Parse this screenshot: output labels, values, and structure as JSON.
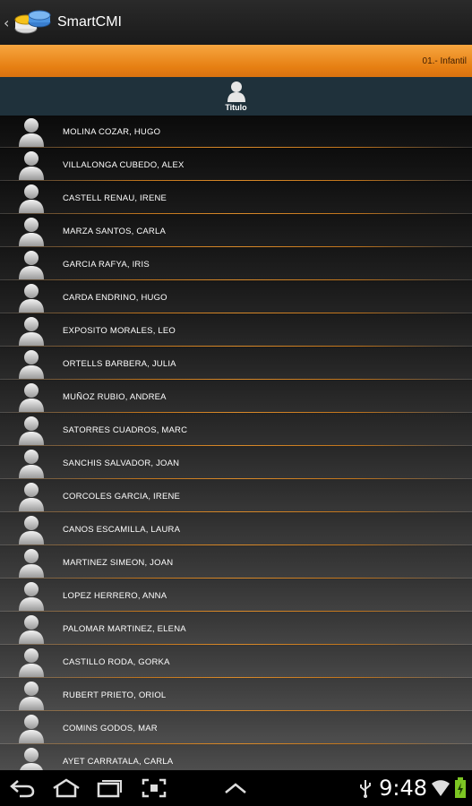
{
  "app": {
    "title": "SmartCMI",
    "up_caret": "‹"
  },
  "subheader": {
    "group": "01.- Infantil"
  },
  "column_header": {
    "title": "Titulo"
  },
  "students": [
    "MOLINA COZAR, HUGO",
    "VILLALONGA CUBEDO, ALEX",
    "CASTELL RENAU, IRENE",
    "MARZA SANTOS, CARLA",
    "GARCIA RAFYA, IRIS",
    "CARDA ENDRINO, HUGO",
    "EXPOSITO MORALES, LEO",
    "ORTELLS BARBERA, JULIA",
    "MUÑOZ RUBIO, ANDREA",
    "SATORRES CUADROS, MARC",
    "SANCHIS SALVADOR, JOAN",
    "CORCOLES GARCIA, IRENE",
    "CANOS ESCAMILLA, LAURA",
    "MARTINEZ SIMEON, JOAN",
    "LOPEZ HERRERO, ANNA",
    "PALOMAR MARTINEZ, ELENA",
    "CASTILLO RODA, GORKA",
    "RUBERT PRIETO, ORIOL",
    "COMINS GODOS, MAR",
    "AYET CARRATALA, CARLA"
  ],
  "status": {
    "time": "9:48"
  },
  "icons": {
    "back": "back-icon",
    "home": "home-icon",
    "recents": "recent-apps-icon",
    "screenshot": "screenshot-icon",
    "menu": "chevron-up-icon",
    "usb": "usb-icon",
    "wifi": "wifi-icon",
    "battery": "battery-icon"
  },
  "colors": {
    "accent": "#e8841a",
    "header": "#1f313b",
    "battery": "#7cc623"
  }
}
